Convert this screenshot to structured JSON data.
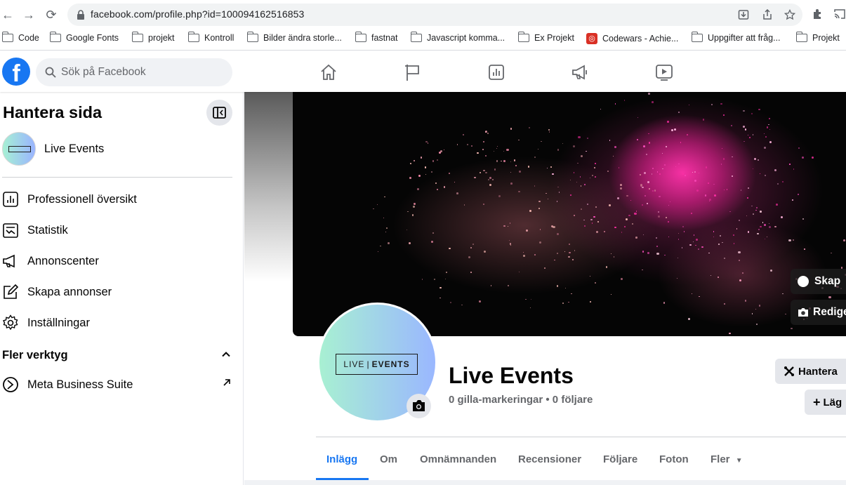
{
  "browser": {
    "url": "facebook.com/profile.php?id=100094162516853",
    "bookmarks": [
      "Code",
      "Google Fonts",
      "projekt",
      "Kontroll",
      "Bilder ändra storle...",
      "fastnat",
      "Javascript komma...",
      "Ex Projekt",
      "Codewars - Achie...",
      "Uppgifter att fråg...",
      "Projekt"
    ]
  },
  "header": {
    "logo_letter": "f",
    "search_placeholder": "Sök på Facebook"
  },
  "sidebar": {
    "title": "Hantera sida",
    "page_name": "Live Events",
    "menu": [
      "Professionell översikt",
      "Statistik",
      "Annonscenter",
      "Skapa annonser",
      "Inställningar"
    ],
    "more_tools": "Fler verktyg",
    "meta_business": "Meta Business Suite"
  },
  "profile": {
    "logo_text_a": "LIVE",
    "logo_text_b": "EVENTS",
    "name": "Live Events",
    "stats": "0 gilla-markeringar • 0 följare",
    "cover_create": "Skap",
    "cover_edit": "Redige",
    "manage_button": "Hantera",
    "add_button": "Läg"
  },
  "tabs": [
    "Inlägg",
    "Om",
    "Omnämnanden",
    "Recensioner",
    "Följare",
    "Foton",
    "Fler"
  ],
  "colors": {
    "facebook_blue": "#1877f2"
  }
}
